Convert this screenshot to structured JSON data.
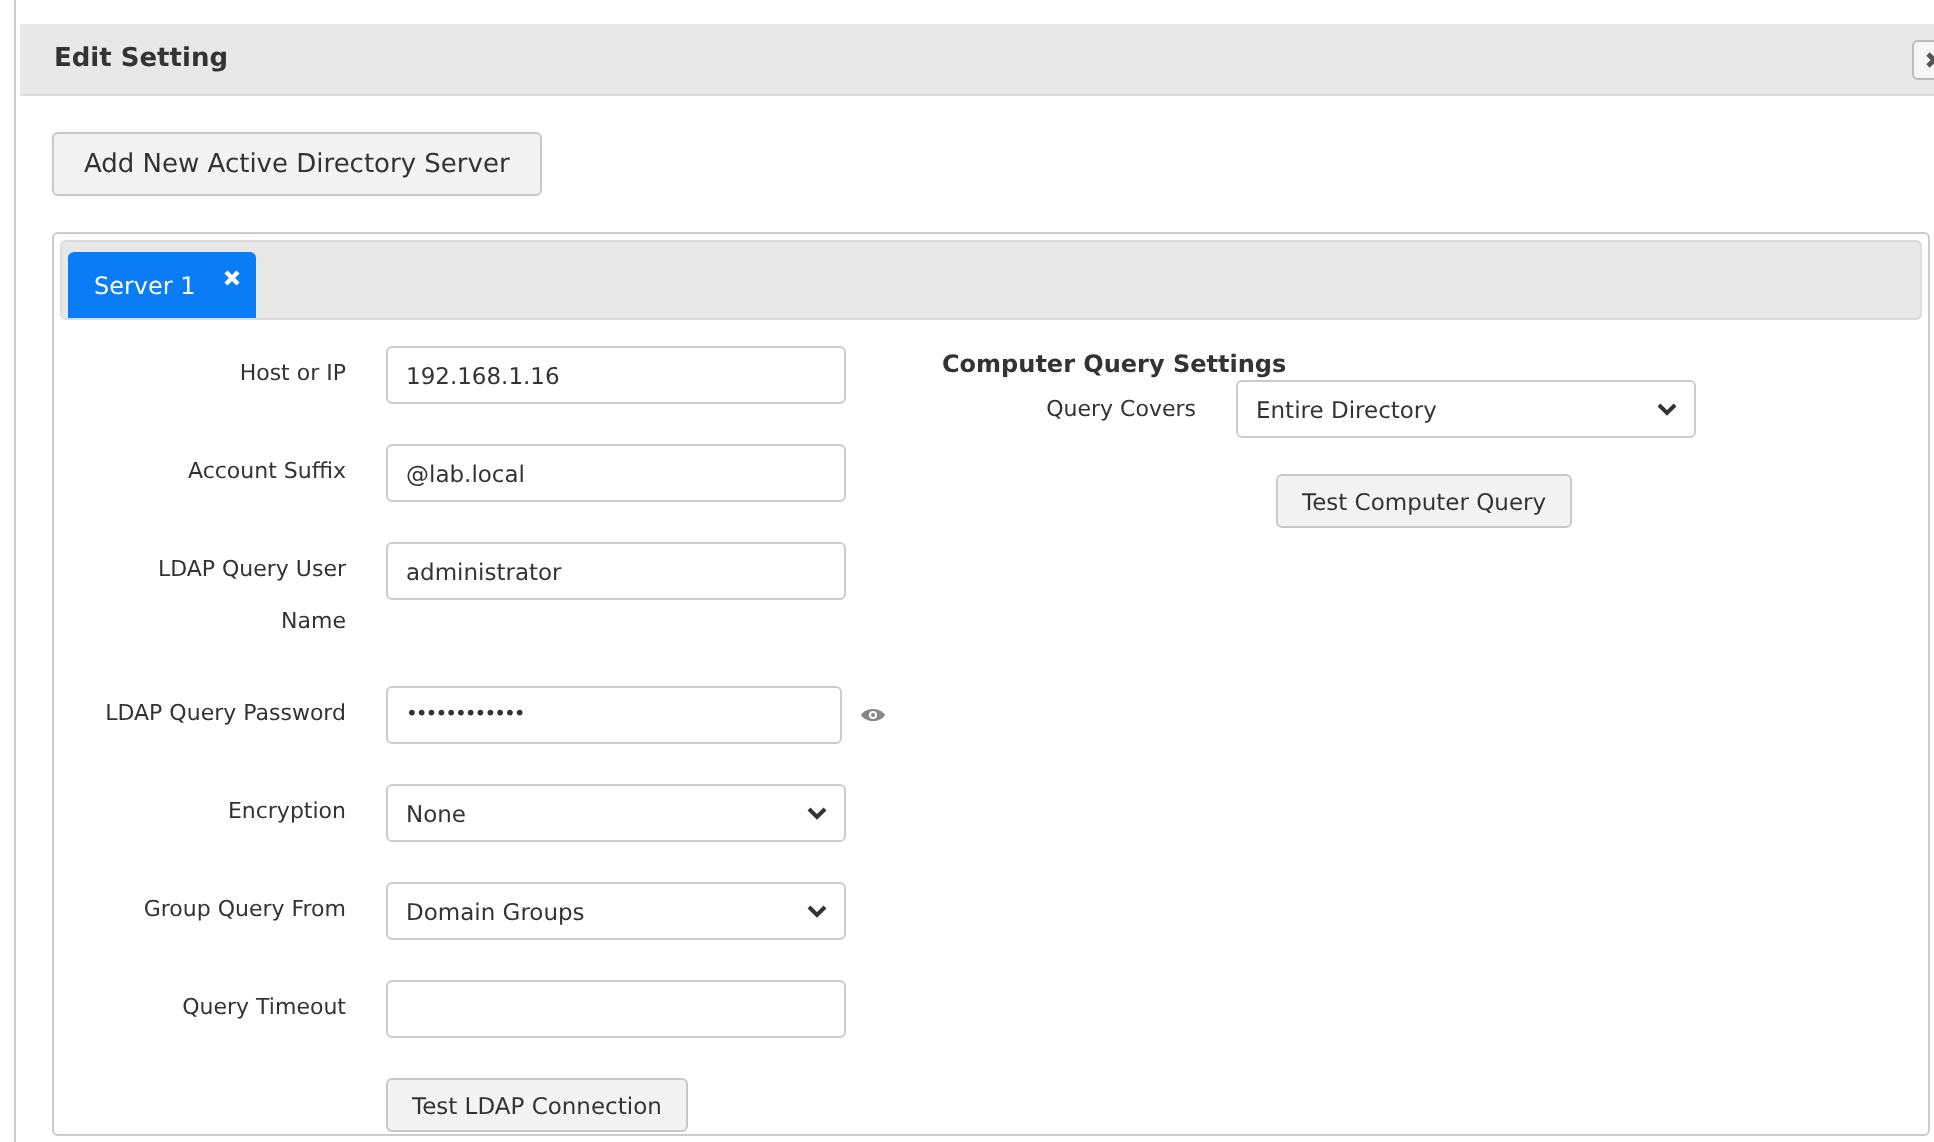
{
  "dialog": {
    "title": "Edit Setting"
  },
  "add_button": "Add New Active Directory Server",
  "tabs": [
    {
      "label": "Server 1",
      "selected": true,
      "closable": true
    }
  ],
  "fields": [
    {
      "label": "Host or IP",
      "kind": "text",
      "value": "192.168.1.16"
    },
    {
      "label": "Account Suffix",
      "kind": "text",
      "value": "@lab.local"
    },
    {
      "label": "LDAP Query User Name",
      "kind": "text",
      "value": "administrator"
    },
    {
      "label": "LDAP Query Password",
      "kind": "password",
      "value": "••••••••••••",
      "reveal": true
    },
    {
      "label": "Encryption",
      "kind": "select",
      "value": "None"
    },
    {
      "label": "Group Query From",
      "kind": "select",
      "value": "Domain Groups"
    },
    {
      "label": "Query Timeout",
      "kind": "text"
    }
  ],
  "test_ldap_button": "Test LDAP Connection",
  "computer_query": {
    "heading": "Computer Query Settings",
    "fields": [
      {
        "label": "Query Covers",
        "kind": "select",
        "value": "Entire Directory"
      }
    ],
    "button": "Test Computer Query"
  }
}
